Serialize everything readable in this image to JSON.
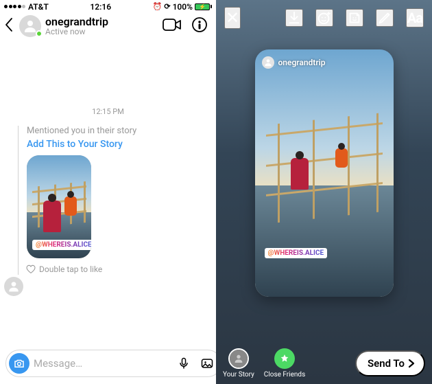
{
  "status_bar": {
    "carrier": "AT&T",
    "time": "12:16",
    "battery_pct": "100%",
    "alarm_icon": "alarm-icon",
    "battery_icon": "battery-full-charging"
  },
  "dm": {
    "username": "onegrandtrip",
    "status": "Active now",
    "timestamp": "12:15 PM",
    "mention_text": "Mentioned you in their story",
    "add_link": "Add This to Your Story",
    "double_tap": "Double tap to like",
    "composer_placeholder": "Message…"
  },
  "editor": {
    "overlay_username": "onegrandtrip",
    "mention_tag": "@WHEREIS.ALICE",
    "text_tool_label": "Aa"
  },
  "share": {
    "your_story": "Your Story",
    "close_friends": "Close Friends",
    "send_to": "Send To"
  }
}
